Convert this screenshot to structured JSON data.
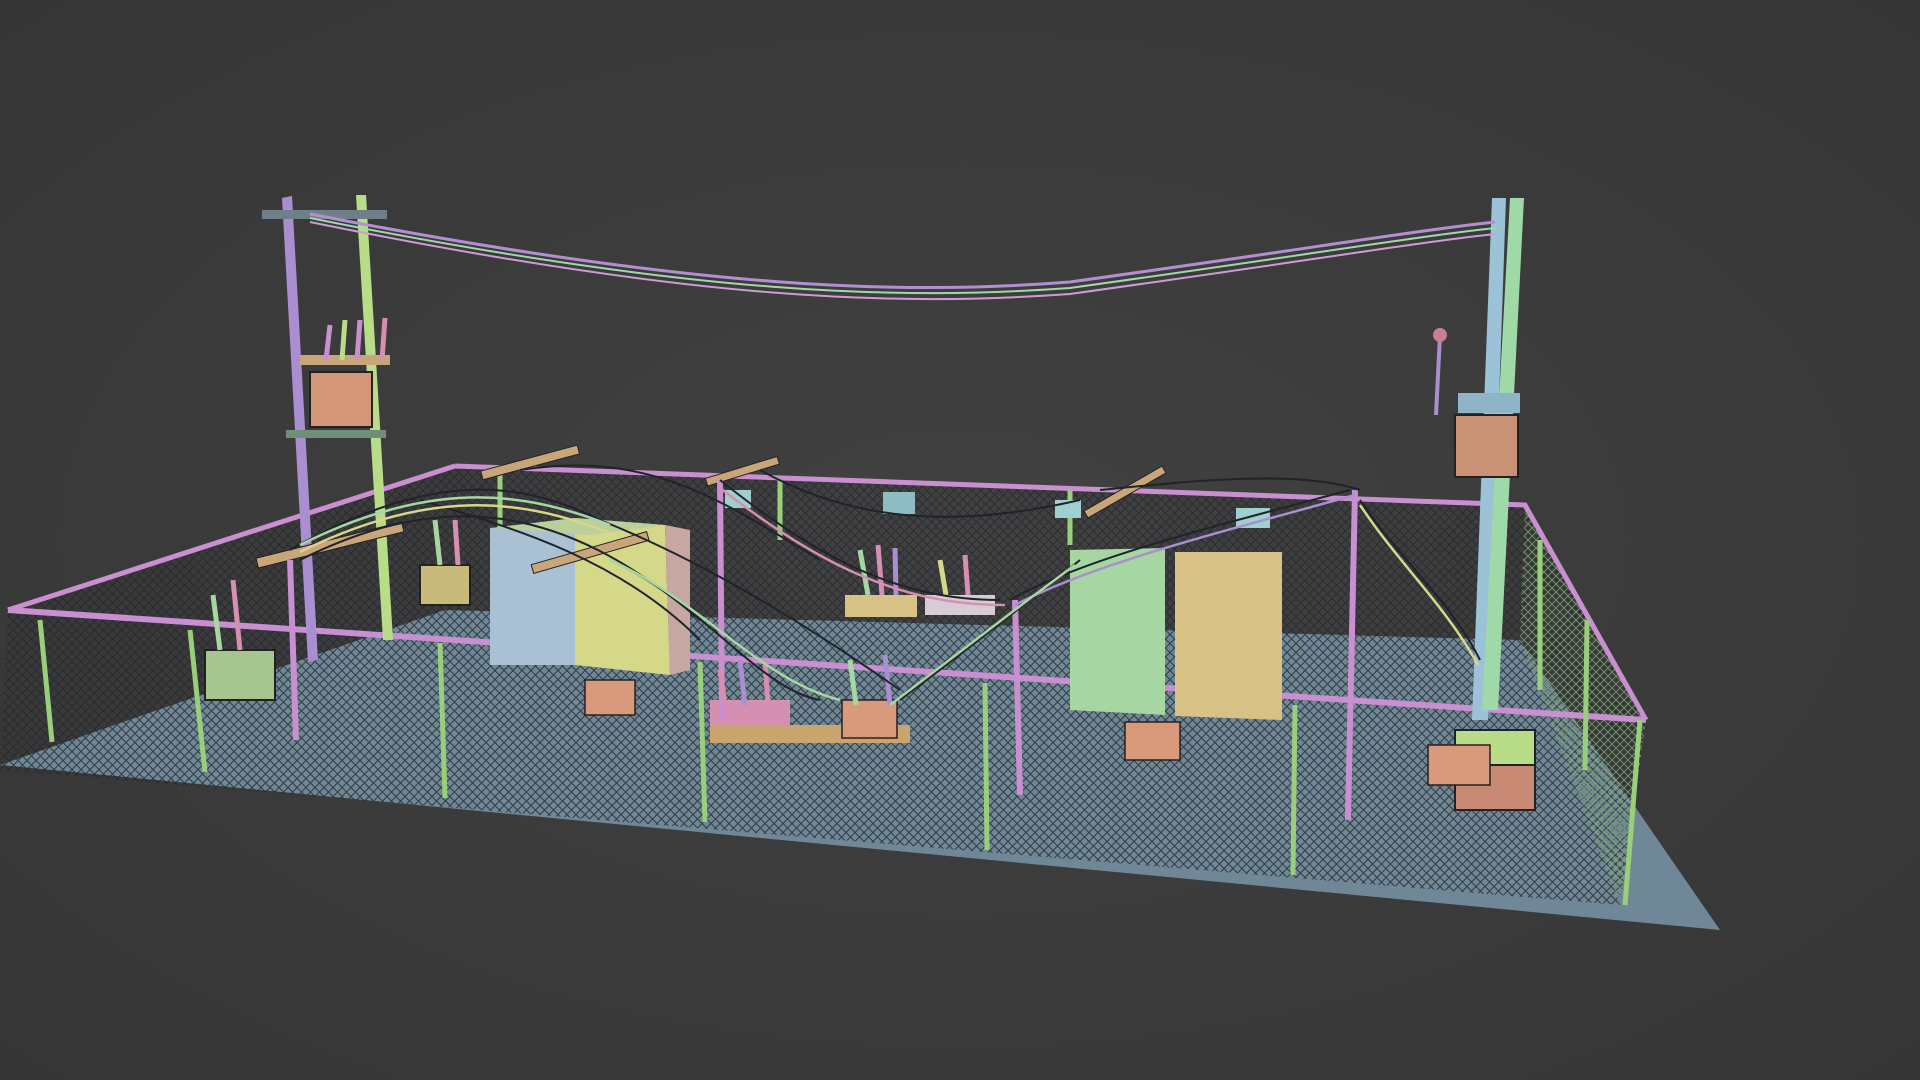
{
  "viewport": {
    "background": "#3b3b3b"
  },
  "scene": {
    "subject": "electrical-substation-wireframe",
    "colors": {
      "ground": "#6f8796",
      "fence_rail": "#c98fd0",
      "fence_mesh": "#2d3036",
      "pole_purple": "#a98fd0",
      "pole_green": "#b9dc88",
      "pole_blue": "#9cc2d8",
      "pole_mint": "#9fd9a8",
      "cabinet_blue": "#a9c1d3",
      "cabinet_yellow": "#d6d889",
      "cabinet_green": "#a6d6a2",
      "cabinet_tan": "#d7c184",
      "sign_orange": "#d89a7a",
      "insulator_pink": "#d58fb0",
      "wire": "#20232a"
    }
  }
}
